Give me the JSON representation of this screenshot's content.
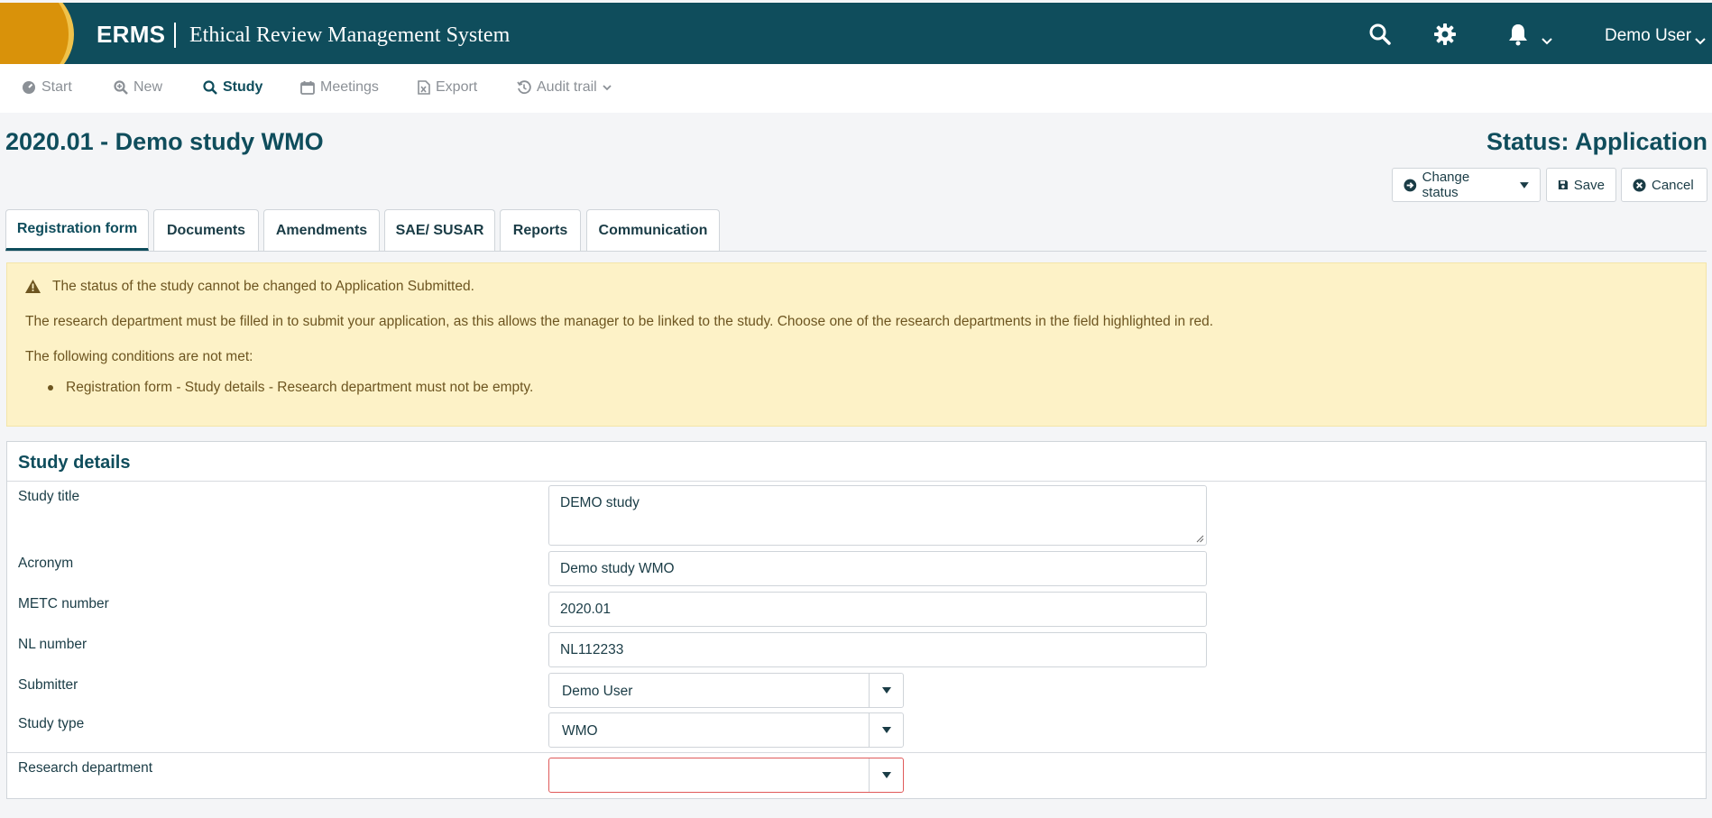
{
  "header": {
    "brand_short": "ERMS",
    "brand_full": "Ethical Review Management System",
    "user_name": "Demo User"
  },
  "nav": {
    "items": [
      {
        "label": "Start",
        "icon": "dashboard-icon"
      },
      {
        "label": "New",
        "icon": "search-plus-icon"
      },
      {
        "label": "Study",
        "icon": "search-icon",
        "active": true
      },
      {
        "label": "Meetings",
        "icon": "calendar-icon"
      },
      {
        "label": "Export",
        "icon": "excel-file-icon"
      },
      {
        "label": "Audit trail",
        "icon": "history-icon"
      }
    ]
  },
  "page": {
    "title": "2020.01 - Demo study WMO",
    "status": "Status: Application"
  },
  "actions": {
    "change_status": "Change status",
    "save": "Save",
    "cancel": "Cancel"
  },
  "tabs": [
    {
      "label": "Registration form",
      "active": true
    },
    {
      "label": "Documents"
    },
    {
      "label": "Amendments"
    },
    {
      "label": "SAE/ SUSAR"
    },
    {
      "label": "Reports"
    },
    {
      "label": "Communication"
    }
  ],
  "alert": {
    "title": "The status of the study cannot be changed to Application Submitted.",
    "body": "The research department must be filled in to submit your application, as this allows the manager to be linked to the study. Choose one of the research departments in the field highlighted in red.",
    "conditions_label": "The following conditions are not met:",
    "conditions": [
      "Registration form - Study details - Research department must not be empty."
    ]
  },
  "study_details": {
    "title": "Study details",
    "fields": {
      "study_title": {
        "label": "Study title",
        "value": "DEMO study"
      },
      "acronym": {
        "label": "Acronym",
        "value": "Demo study WMO"
      },
      "metc_number": {
        "label": "METC number",
        "value": "2020.01"
      },
      "nl_number": {
        "label": "NL number",
        "value": "NL112233"
      },
      "submitter": {
        "label": "Submitter",
        "value": "Demo User"
      },
      "study_type": {
        "label": "Study type",
        "value": "WMO"
      },
      "research_department": {
        "label": "Research department",
        "value": ""
      }
    }
  },
  "colors": {
    "header_bg": "#0f4d5c",
    "logo_accent": "#d9920a",
    "alert_bg": "#fdf2c7",
    "error_border": "#e05a5a"
  }
}
